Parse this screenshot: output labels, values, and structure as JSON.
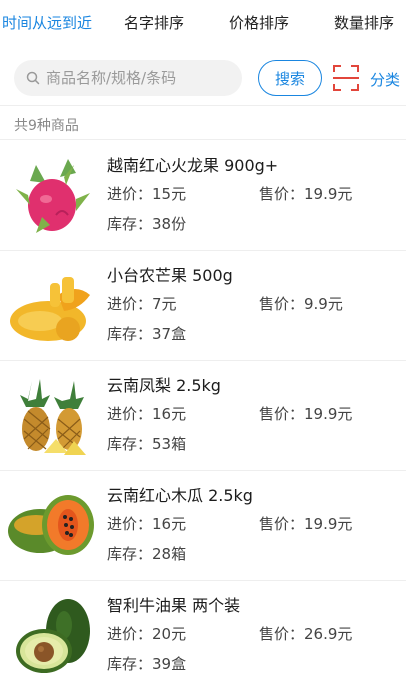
{
  "sort_tabs": [
    {
      "label": "时间从远到近",
      "active": true
    },
    {
      "label": "名字排序",
      "active": false
    },
    {
      "label": "价格排序",
      "active": false
    },
    {
      "label": "数量排序",
      "active": false
    }
  ],
  "search": {
    "placeholder": "商品名称/规格/条码",
    "value": "",
    "button_label": "搜索",
    "scan_icon": "scan-icon",
    "category_label": "分类"
  },
  "summary": "共9种商品",
  "colors": {
    "accent": "#1a86e0",
    "scan": "#e2463b"
  },
  "products": [
    {
      "name": "越南红心火龙果  900g+",
      "cost": "进价：15元",
      "price": "售价：19.9元",
      "stock": "库存：38份",
      "image": "dragon-fruit"
    },
    {
      "name": "小台农芒果  500g",
      "cost": "进价：7元",
      "price": "售价：9.9元",
      "stock": "库存：37盒",
      "image": "mango"
    },
    {
      "name": "云南凤梨  2.5kg",
      "cost": "进价：16元",
      "price": "售价：19.9元",
      "stock": "库存：53箱",
      "image": "pineapple"
    },
    {
      "name": "云南红心木瓜  2.5kg",
      "cost": "进价：16元",
      "price": "售价：19.9元",
      "stock": "库存：28箱",
      "image": "papaya"
    },
    {
      "name": "智利牛油果  两个装",
      "cost": "进价：20元",
      "price": "售价：26.9元",
      "stock": "库存：39盒",
      "image": "avocado"
    }
  ]
}
